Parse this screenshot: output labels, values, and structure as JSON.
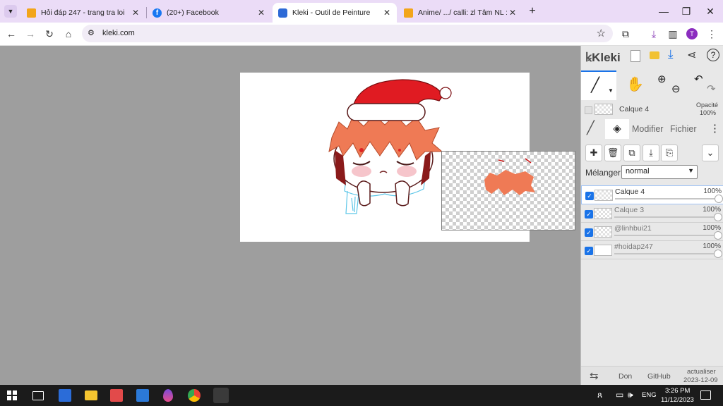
{
  "browser": {
    "tabs": [
      {
        "title": "Hỏi đáp 247 - trang tra loi",
        "active": false
      },
      {
        "title": "(20+) Facebook",
        "active": false
      },
      {
        "title": "Kleki - Outil de Peinture",
        "active": true
      },
      {
        "title": "Anime/ .../ calli: zl Tâm NL : tro",
        "active": false
      }
    ],
    "new_tab": "+",
    "url": "kleki.com",
    "profile_initial": "T"
  },
  "kleki": {
    "logo": "Kleki",
    "current_layer": {
      "name": "Calque 4",
      "opacity_label": "Opacité",
      "opacity": "100%"
    },
    "tabs": {
      "modify": "Modifier",
      "file": "Fichier"
    },
    "blend": {
      "label": "Mélanger",
      "value": "normal"
    },
    "layers": [
      {
        "name": "Calque 4",
        "opacity": "100%"
      },
      {
        "name": "Calque 3",
        "opacity": "100%"
      },
      {
        "name": "@linhbui21",
        "opacity": "100%"
      },
      {
        "name": "#hoidap247",
        "opacity": "100%"
      }
    ],
    "footer": {
      "donate": "Don",
      "github": "GitHub",
      "update_label": "actualiser",
      "update_date": "2023-12-09"
    }
  },
  "taskbar": {
    "lang": "ENG",
    "time": "3:26 PM",
    "date": "11/12/2023"
  },
  "colors": {
    "accent": "#1a73e8",
    "tabstrip": "#ebdcf7",
    "stage": "#9e9e9e",
    "panel": "#e8e8e8",
    "santa_red": "#e01b22",
    "hair": "#ef7a55"
  }
}
